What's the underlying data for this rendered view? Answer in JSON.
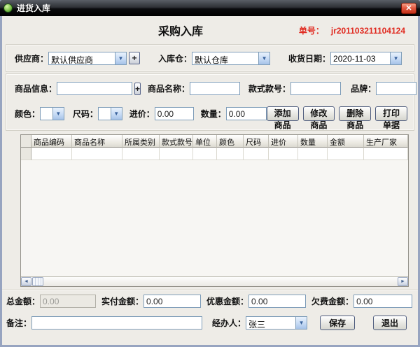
{
  "window": {
    "title": "进货入库"
  },
  "icons": {
    "close": "✕",
    "chevron_down": "▼",
    "plus": "+",
    "scroll_left": "◄",
    "scroll_right": "►"
  },
  "colors": {
    "accent_red": "#e02a20",
    "titlebar_dark": "#1a1d21",
    "input_border_blue": "#7f9db9"
  },
  "header": {
    "title": "采购入库",
    "order_label": "单号：",
    "order_value": "jr201103211104124"
  },
  "supplier_row": {
    "supplier_label": "供应商：",
    "supplier_value": "默认供应商",
    "warehouse_label": "入库仓：",
    "warehouse_value": "默认仓库",
    "date_label": "收货日期：",
    "date_value": "2020-11-03"
  },
  "product_row": {
    "info_label": "商品信息：",
    "info_value": "",
    "name_label": "商品名称：",
    "name_value": "",
    "style_label": "款式款号：",
    "style_value": "",
    "brand_label": "品牌：",
    "brand_value": ""
  },
  "entry_row": {
    "color_label": "颜色：",
    "color_value": "",
    "size_label": "尺码：",
    "size_value": "",
    "price_label": "进价：",
    "price_value": "0.00",
    "qty_label": "数量：",
    "qty_value": "0.00",
    "buttons": [
      {
        "label": "添加商品"
      },
      {
        "label": "修改商品"
      },
      {
        "label": "删除商品"
      },
      {
        "label": "打印单据"
      }
    ]
  },
  "grid": {
    "columns": [
      "商品编码",
      "商品名称",
      "所属类别",
      "款式款号",
      "单位",
      "颜色",
      "尺码",
      "进价",
      "数量",
      "金额",
      "生产厂家"
    ],
    "rows": [
      [
        "",
        "",
        "",
        "",
        "",
        "",
        "",
        "",
        "",
        "",
        ""
      ]
    ]
  },
  "totals_row": {
    "total_label": "总金额：",
    "total_value": "0.00",
    "paid_label": "实付金额：",
    "paid_value": "0.00",
    "discount_label": "优惠金额：",
    "discount_value": "0.00",
    "owed_label": "欠费金额：",
    "owed_value": "0.00"
  },
  "footer_row": {
    "remark_label": "备注：",
    "remark_value": "",
    "handler_label": "经办人：",
    "handler_value": "张三",
    "save_label": "保存",
    "exit_label": "退出"
  }
}
